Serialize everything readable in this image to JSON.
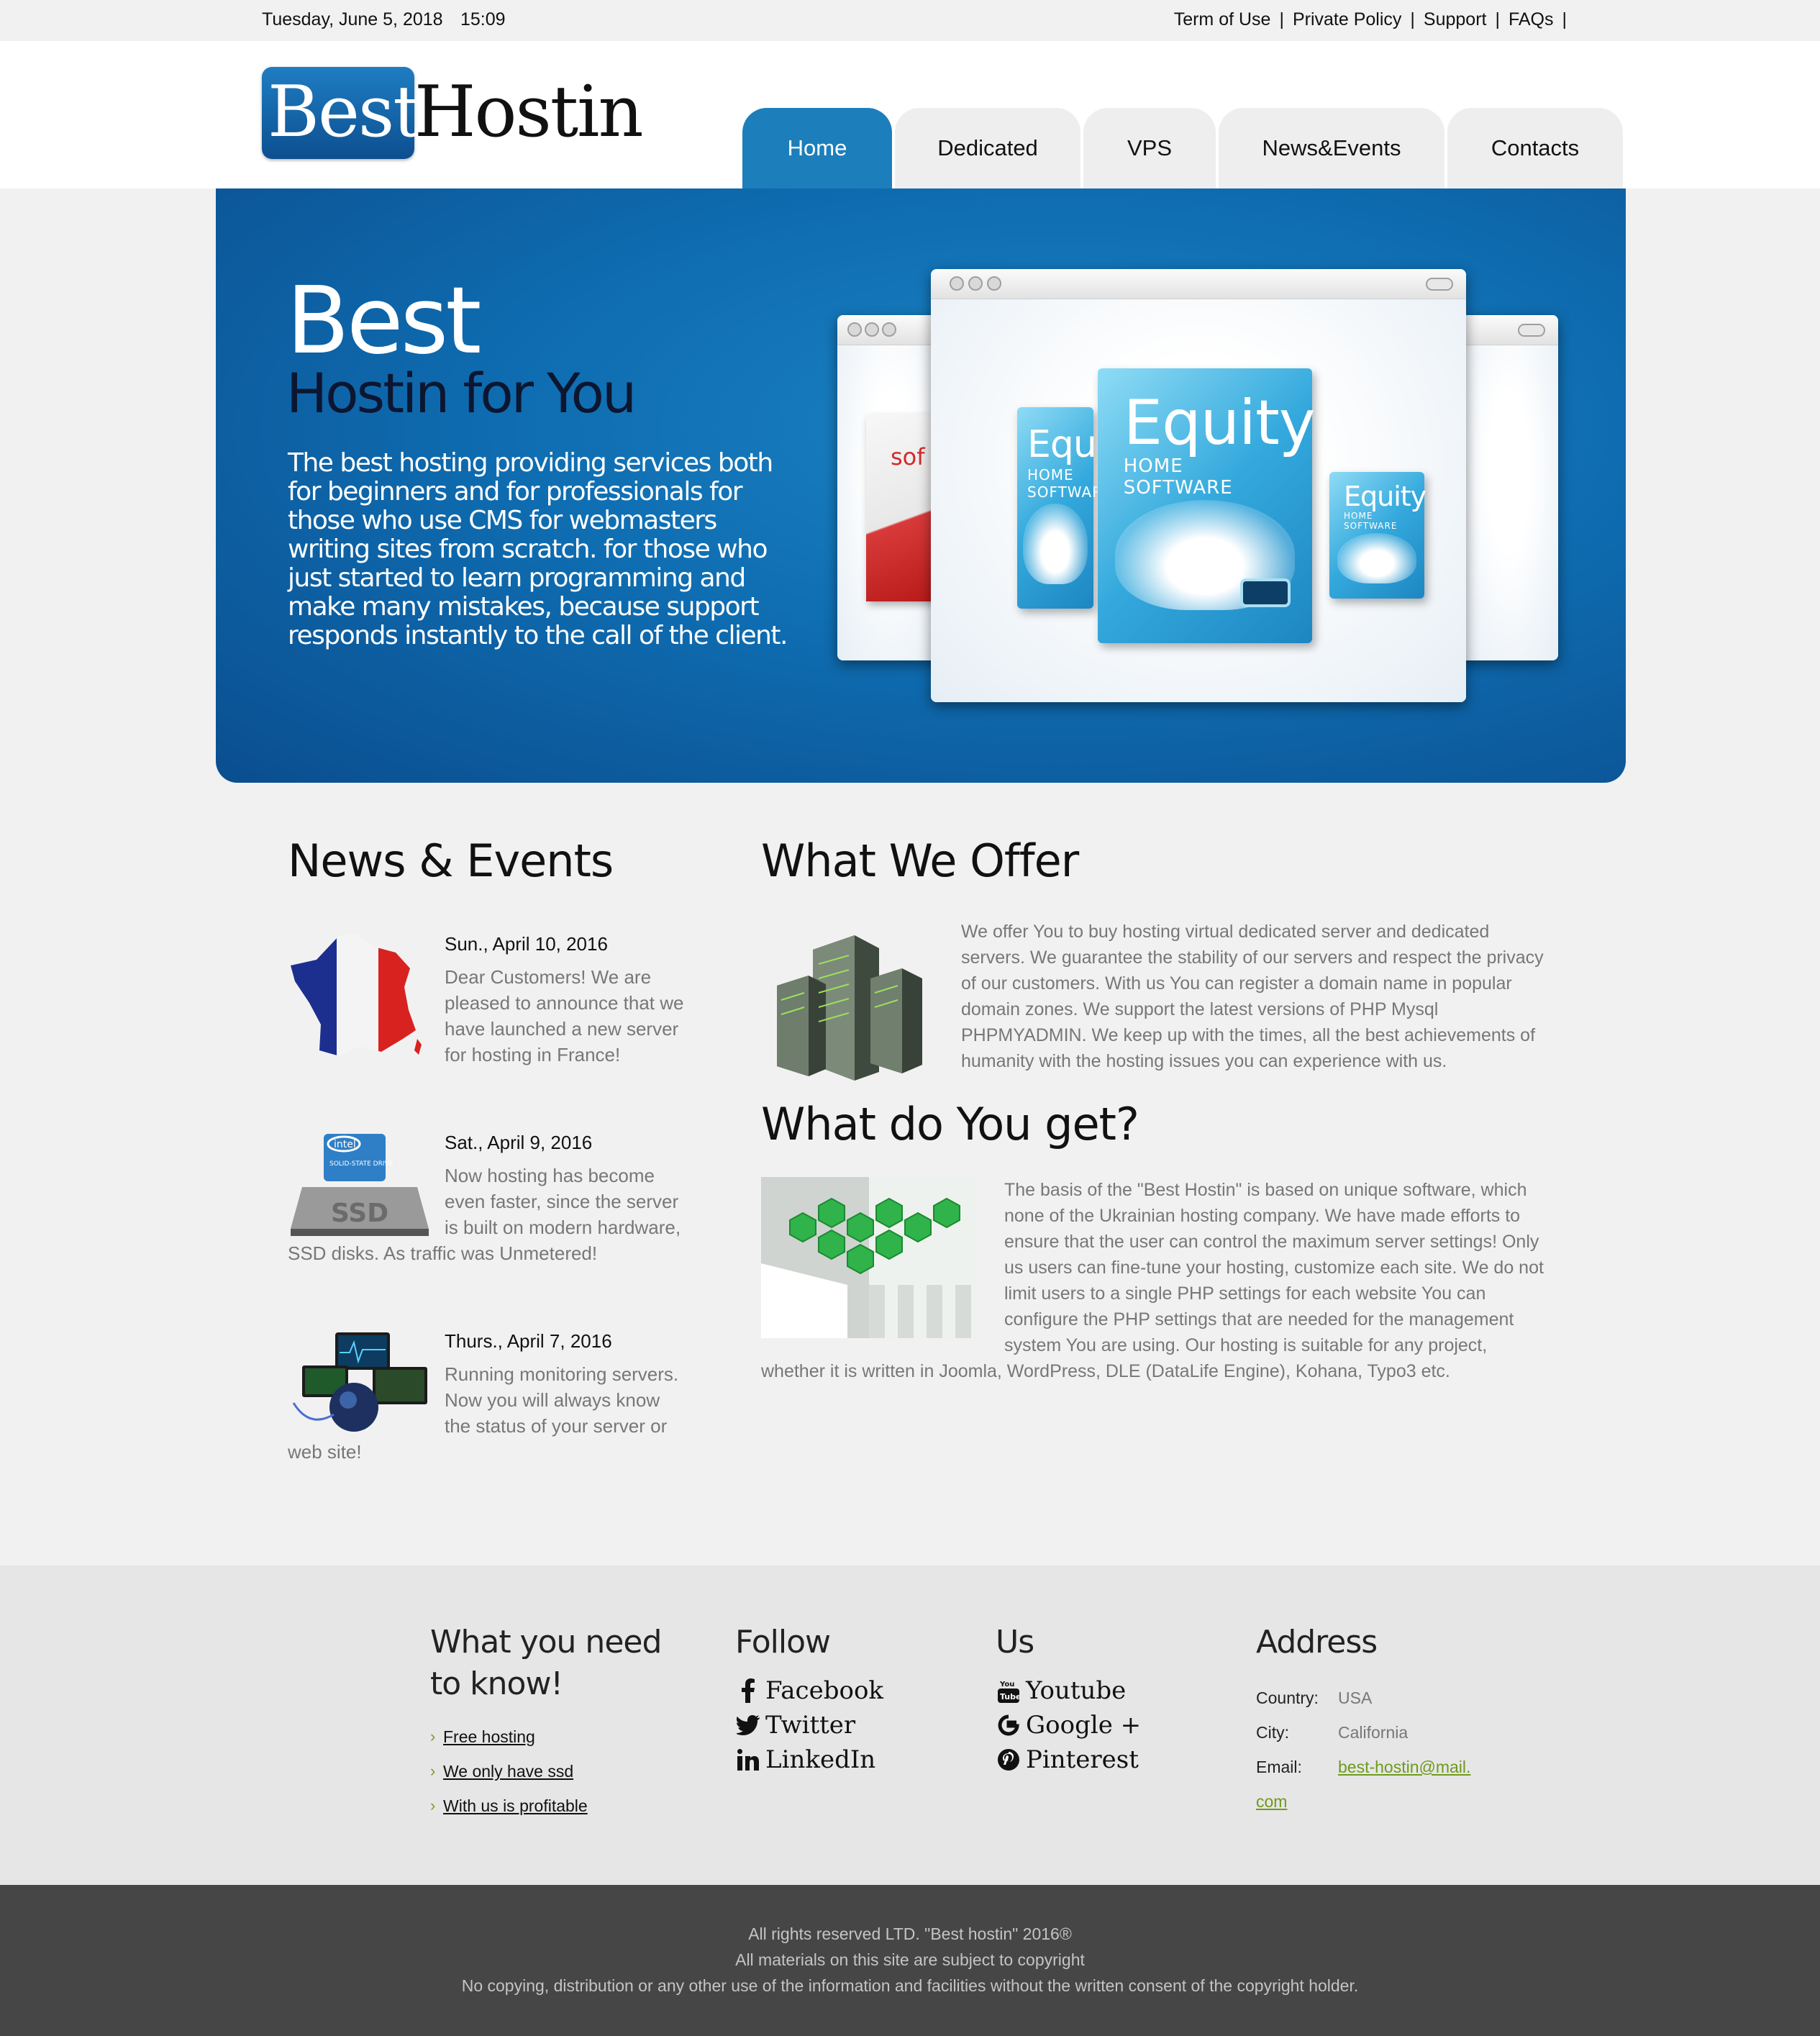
{
  "topbar": {
    "date": "Tuesday, June 5, 2018",
    "time": "15:09",
    "links": [
      "Term of Use",
      "Private Policy",
      "Support",
      "FAQs"
    ],
    "separator": "|"
  },
  "logo": {
    "part1": "Best",
    "part2": "Hostin"
  },
  "nav": {
    "tabs": [
      "Home",
      "Dedicated",
      "VPS",
      "News&Events",
      "Contacts"
    ],
    "active": "Home"
  },
  "hero": {
    "title": "Best",
    "subtitle": "Hostin for You",
    "text": "The best hosting providing services both for beginners and for professionals for those who use CMS for webmasters writing sites from scratch. for those who just started to learn programming and make many mistakes, because support responds instantly to the call of the client.",
    "product_brand": "Equity",
    "product_line1": "HOME",
    "product_line2": "SOFTWARE",
    "red_box_text": "sof"
  },
  "news": {
    "title": "News & Events",
    "items": [
      {
        "date": "Sun., April 10, 2016",
        "text": "Dear Customers! We are pleased to announce that we have launched a new server for hosting in France!",
        "icon": "france-map-icon"
      },
      {
        "date": "Sat., April 9, 2016",
        "text": "Now hosting has become even faster, since the server is built on modern hardware, SSD disks. As traffic was Unmetered!",
        "icon": "ssd-drive-icon"
      },
      {
        "date": "Thurs., April 7, 2016",
        "text": "Running monitoring servers. Now you will always know the status of your server or web site!",
        "icon": "monitoring-icon"
      }
    ],
    "ssd_badge": "intel",
    "ssd_label": "SSD",
    "ssd_badge_text": "SOLID-STATE DRIVE"
  },
  "offer": {
    "title": "What We Offer",
    "text": "We offer You to buy hosting virtual dedicated server and dedicated servers. We guarantee the stability of our servers and respect the privacy of our customers. With us You can register a domain name in popular domain zones. We support the latest versions of PHP Mysql PHPMYADMIN. We keep up with the times, all the best achievements of humanity with the hosting issues you can experience with us."
  },
  "get": {
    "title": "What do You get?",
    "text": "The basis of the \"Best Hostin\" is based on unique software, which none of the Ukrainian hosting company. We have made efforts to ensure that the user can control the maximum server settings! Only us users can fine-tune your hosting, customize each site. We do not limit users to a single PHP settings for each website You can configure the PHP settings that are needed for the management system You are using. Our hosting is suitable for any project, whether it is written in Joomla, WordPress, DLE (DataLife Engine), Kohana, Typo3 etc."
  },
  "footer": {
    "know_title": "What you need to know!",
    "know_links": [
      "Free hosting",
      "We only have ssd",
      "With us is profitable"
    ],
    "follow_title": "Follow",
    "follow_links": [
      "Facebook",
      "Twitter",
      "LinkedIn"
    ],
    "us_title": "Us",
    "us_links": [
      "Youtube",
      "Google +",
      "Pinterest"
    ],
    "address_title": "Address",
    "address": {
      "country_label": "Country:",
      "country": "USA",
      "city_label": "City:",
      "city": "California",
      "email_label": "Email:",
      "email": "best-hostin@mail.com"
    }
  },
  "bottom": {
    "line1": "All rights reserved LTD. \"Best hostin\" 2016®",
    "line2": "All materials on this site are subject to copyright",
    "line3": "No copying, distribution or any other use of the information and facilities without the written consent of the copyright holder."
  },
  "colors": {
    "accent_blue": "#1c7fbc",
    "hero_dark": "#0a4e8f",
    "link_green": "#6f9a1c",
    "footer_dark": "#464646"
  }
}
